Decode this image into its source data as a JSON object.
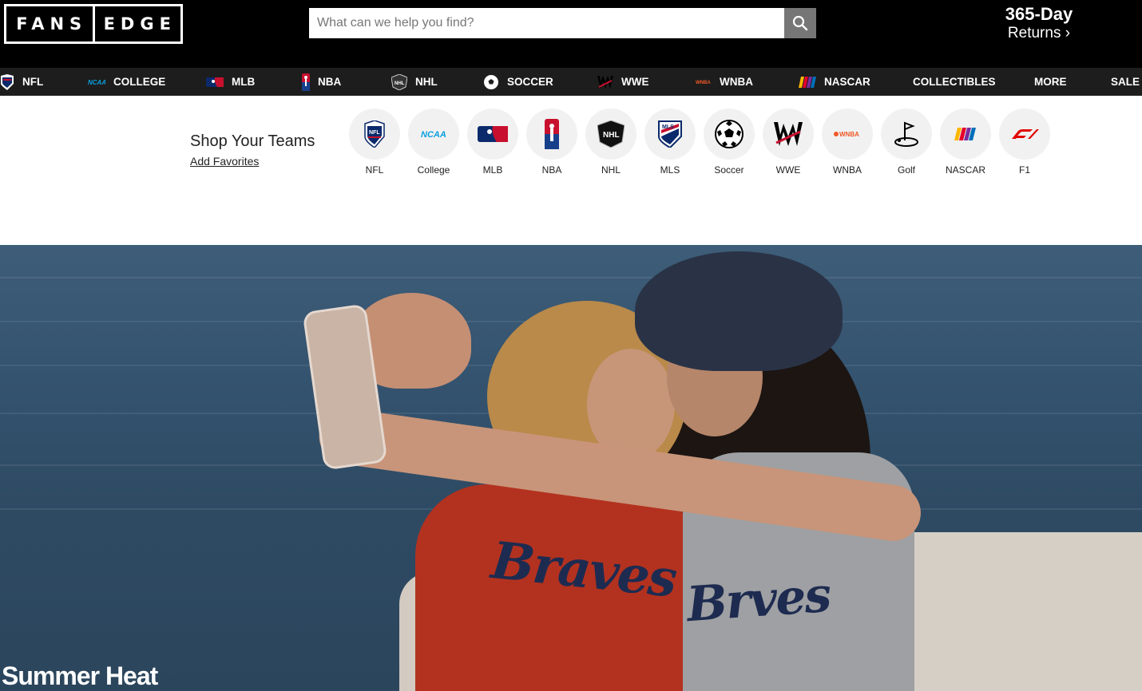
{
  "header": {
    "logo_left": "FANS",
    "logo_right": "EDGE",
    "search_placeholder": "What can we help you find?",
    "returns_line1": "365-Day",
    "returns_line2": "Returns ›"
  },
  "nav": [
    {
      "label": "NFL",
      "icon": "nfl-shield-icon"
    },
    {
      "label": "COLLEGE",
      "icon": "ncaa-icon"
    },
    {
      "label": "MLB",
      "icon": "mlb-icon"
    },
    {
      "label": "NBA",
      "icon": "nba-icon"
    },
    {
      "label": "NHL",
      "icon": "nhl-icon"
    },
    {
      "label": "SOCCER",
      "icon": "soccer-ball-icon"
    },
    {
      "label": "WWE",
      "icon": "wwe-icon"
    },
    {
      "label": "WNBA",
      "icon": "wnba-icon"
    },
    {
      "label": "NASCAR",
      "icon": "nascar-icon"
    },
    {
      "label": "COLLECTIBLES",
      "icon": ""
    },
    {
      "label": "MORE",
      "icon": ""
    },
    {
      "label": "SALE",
      "icon": ""
    }
  ],
  "teams": {
    "title": "Shop Your Teams",
    "add_link": "Add Favorites",
    "items": [
      {
        "label": "NFL",
        "icon": "nfl-shield-icon"
      },
      {
        "label": "College",
        "icon": "ncaa-icon"
      },
      {
        "label": "MLB",
        "icon": "mlb-icon"
      },
      {
        "label": "NBA",
        "icon": "nba-icon"
      },
      {
        "label": "NHL",
        "icon": "nhl-icon"
      },
      {
        "label": "MLS",
        "icon": "mls-icon"
      },
      {
        "label": "Soccer",
        "icon": "soccer-ball-icon"
      },
      {
        "label": "WWE",
        "icon": "wwe-icon"
      },
      {
        "label": "WNBA",
        "icon": "wnba-icon"
      },
      {
        "label": "Golf",
        "icon": "golf-icon"
      },
      {
        "label": "NASCAR",
        "icon": "nascar-icon"
      },
      {
        "label": "F1",
        "icon": "f1-icon"
      }
    ]
  },
  "hero": {
    "headline": "Summer Heat",
    "jersey_text_1": "Braves",
    "jersey_text_2": "Brves"
  },
  "colors": {
    "header_bg": "#000000",
    "nav_bg": "#1d1d1d",
    "search_button": "#767676",
    "team_circle": "#f1f1f1"
  }
}
